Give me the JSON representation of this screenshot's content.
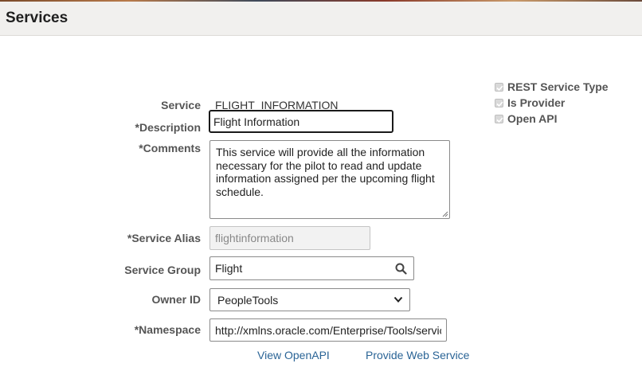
{
  "header": {
    "title": "Services"
  },
  "flags": {
    "rest_service_type": {
      "label": "REST Service Type",
      "checked": true
    },
    "is_provider": {
      "label": "Is Provider",
      "checked": true
    },
    "open_api": {
      "label": "Open API",
      "checked": true
    }
  },
  "form": {
    "service": {
      "label": "Service",
      "value": "FLIGHT_INFORMATION"
    },
    "description": {
      "label": "*Description",
      "value": "Flight Information"
    },
    "comments": {
      "label": "*Comments",
      "value": "This service will provide all the information necessary for the pilot to read and update information assigned per the upcoming flight schedule."
    },
    "service_alias": {
      "label": "*Service Alias",
      "value": "flightinformation"
    },
    "service_group": {
      "label": "Service Group",
      "value": "Flight"
    },
    "owner_id": {
      "label": "Owner ID",
      "value": "PeopleTools"
    },
    "namespace": {
      "label": "*Namespace",
      "value": "http://xmlns.oracle.com/Enterprise/Tools/services"
    }
  },
  "links": {
    "view_openapi": "View OpenAPI",
    "provide_web_service": "Provide Web Service"
  },
  "icons": {
    "search": "search-icon",
    "dropdown": "chevron-down-icon",
    "check": "checkmark-icon"
  }
}
